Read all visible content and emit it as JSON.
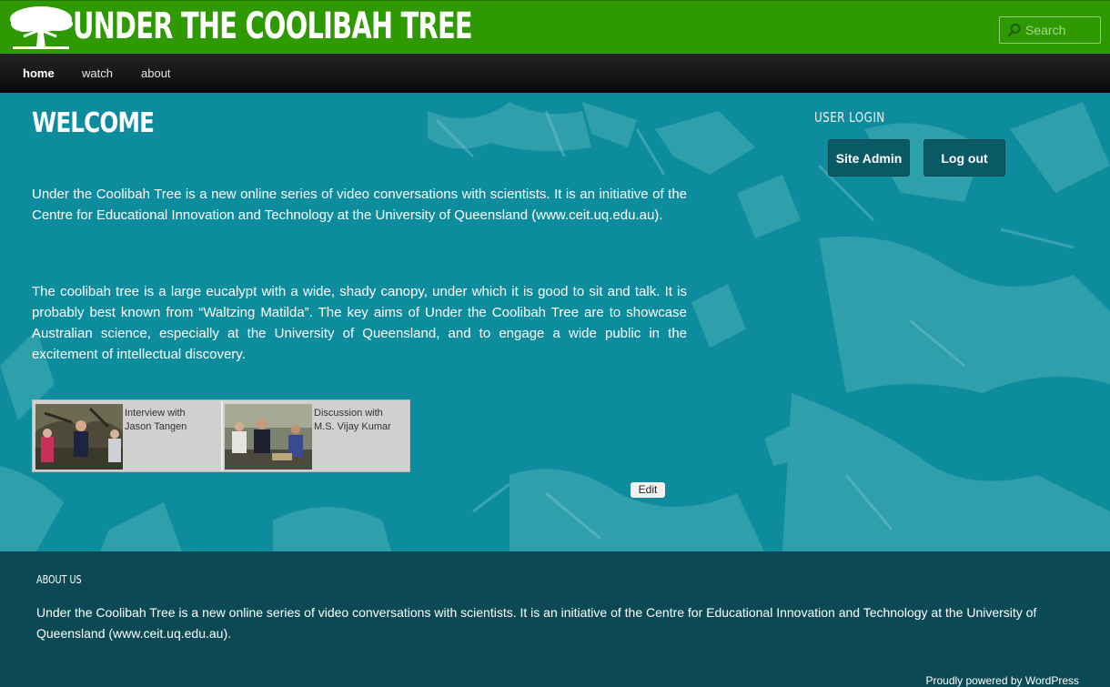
{
  "header": {
    "site_title": "UNDER THE COOLIBAH TREE",
    "logo_icon": "coolibah-tree-logo-icon",
    "search_placeholder": "Search",
    "search_icon": "search-icon"
  },
  "nav": {
    "items": [
      {
        "label": "home",
        "active": true
      },
      {
        "label": "watch",
        "active": false
      },
      {
        "label": "about",
        "active": false
      }
    ]
  },
  "main": {
    "heading": "WELCOME",
    "paragraphs": [
      "Under the Coolibah Tree is a new online series of video conversations with scientists. It is an initiative of the Centre for Educational Innovation and Technology at the University of Queensland (www.ceit.uq.edu.au).",
      "The coolibah tree is a large eucalypt with a wide, shady canopy, under which it is good to sit and talk. It is probably best known from “Waltzing Matilda”. The key aims of Under the Coolibah Tree are to showcase Australian science, especially at the University of Queensland, and to engage a wide public in the excitement of intellectual discovery."
    ],
    "videos": [
      {
        "line1": "Interview with",
        "line2": "Jason Tangen"
      },
      {
        "line1": "Discussion with",
        "line2": "M.S. Vijay Kumar"
      }
    ],
    "edit_label": "Edit"
  },
  "sidebar": {
    "title": "USER LOGIN",
    "site_admin_label": "Site Admin",
    "logout_label": "Log out"
  },
  "footer": {
    "title": "ABOUT US",
    "text": "Under the Coolibah Tree is a new online series of video conversations with scientists. It is an initiative of the Centre for Educational Innovation and Technology at the University of Queensland (www.ceit.uq.edu.au).",
    "powered": "Proudly powered by WordPress"
  },
  "colors": {
    "header_green": "#2e9900",
    "main_teal": "#0d8c9e",
    "footer_dark_teal": "#0b4a55",
    "button_teal": "#0a5a66"
  }
}
